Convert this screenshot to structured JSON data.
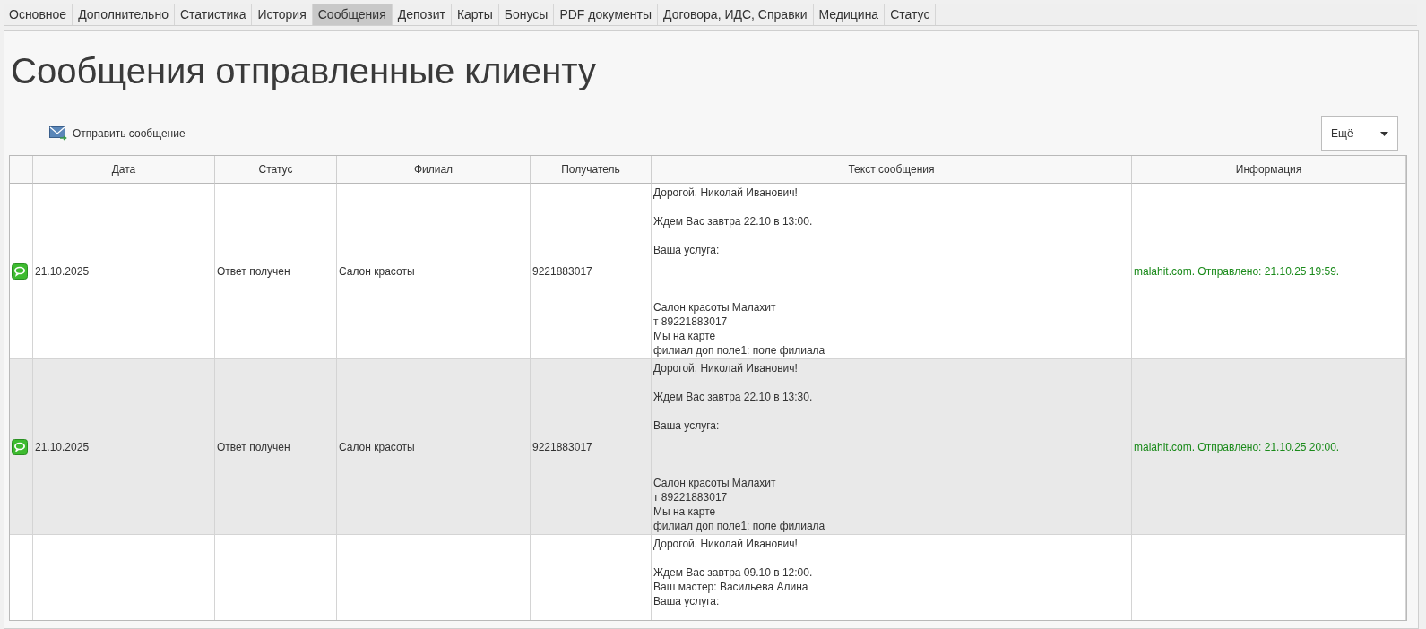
{
  "tabs": [
    {
      "label": "Основное",
      "selected": false
    },
    {
      "label": "Дополнительно",
      "selected": false
    },
    {
      "label": "Статистика",
      "selected": false
    },
    {
      "label": "История",
      "selected": false
    },
    {
      "label": "Сообщения",
      "selected": true
    },
    {
      "label": "Депозит",
      "selected": false
    },
    {
      "label": "Карты",
      "selected": false
    },
    {
      "label": "Бонусы",
      "selected": false
    },
    {
      "label": "PDF документы",
      "selected": false
    },
    {
      "label": "Договора, ИДС, Справки",
      "selected": false
    },
    {
      "label": "Медицина",
      "selected": false
    },
    {
      "label": "Статус",
      "selected": false
    }
  ],
  "page_title": "Сообщения отправленные клиенту",
  "toolbar": {
    "send_button": "Отправить сообщение",
    "more_dropdown": "Ещё"
  },
  "table": {
    "columns": [
      "Дата",
      "Статус",
      "Филиал",
      "Получатель",
      "Текст сообщения",
      "Информация"
    ],
    "rows": [
      {
        "has_icon": true,
        "date": "21.10.2025",
        "status": "Ответ получен",
        "branch": "Салон красоты",
        "recipient": "9221883017",
        "message": "Дорогой, Николай Иванович!\n\nЖдем Вас завтра 22.10 в 13:00.\n\nВаша услуга:\n\n\n\nСалон красоты Малахит\nт 89221883017\nМы на карте\nфилиал доп поле1: поле филиала",
        "info": "malahit.com. Отправлено: 21.10.25 19:59."
      },
      {
        "has_icon": true,
        "date": "21.10.2025",
        "status": "Ответ получен",
        "branch": "Салон красоты",
        "recipient": "9221883017",
        "message": "Дорогой, Николай Иванович!\n\nЖдем Вас завтра 22.10 в 13:30.\n\nВаша услуга:\n\n\n\nСалон красоты Малахит\nт 89221883017\nМы на карте\nфилиал доп поле1: поле филиала",
        "info": "malahit.com. Отправлено: 21.10.25 20:00."
      },
      {
        "has_icon": false,
        "message": "Дорогой, Николай Иванович!\n\nЖдем Вас завтра 09.10 в 12:00.\nВаш мастер: Васильева Алина\nВаша услуга:"
      }
    ]
  }
}
